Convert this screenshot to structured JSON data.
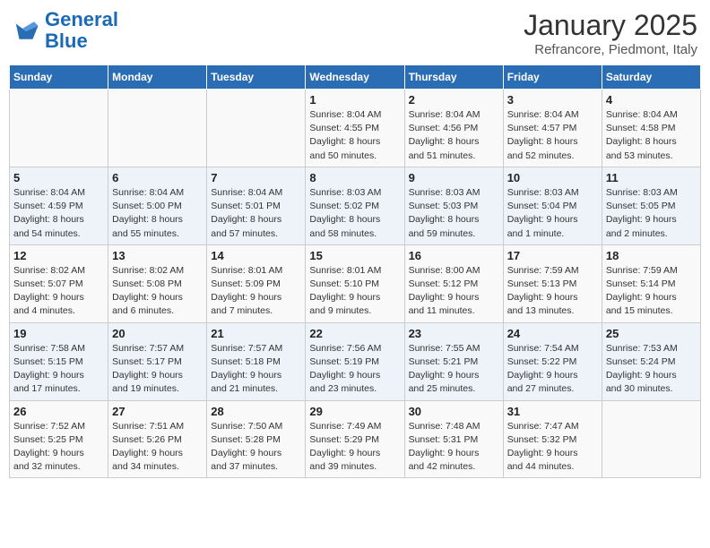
{
  "logo": {
    "line1": "General",
    "line2": "Blue"
  },
  "title": "January 2025",
  "subtitle": "Refrancore, Piedmont, Italy",
  "weekdays": [
    "Sunday",
    "Monday",
    "Tuesday",
    "Wednesday",
    "Thursday",
    "Friday",
    "Saturday"
  ],
  "weeks": [
    [
      {
        "day": "",
        "info": ""
      },
      {
        "day": "",
        "info": ""
      },
      {
        "day": "",
        "info": ""
      },
      {
        "day": "1",
        "info": "Sunrise: 8:04 AM\nSunset: 4:55 PM\nDaylight: 8 hours\nand 50 minutes."
      },
      {
        "day": "2",
        "info": "Sunrise: 8:04 AM\nSunset: 4:56 PM\nDaylight: 8 hours\nand 51 minutes."
      },
      {
        "day": "3",
        "info": "Sunrise: 8:04 AM\nSunset: 4:57 PM\nDaylight: 8 hours\nand 52 minutes."
      },
      {
        "day": "4",
        "info": "Sunrise: 8:04 AM\nSunset: 4:58 PM\nDaylight: 8 hours\nand 53 minutes."
      }
    ],
    [
      {
        "day": "5",
        "info": "Sunrise: 8:04 AM\nSunset: 4:59 PM\nDaylight: 8 hours\nand 54 minutes."
      },
      {
        "day": "6",
        "info": "Sunrise: 8:04 AM\nSunset: 5:00 PM\nDaylight: 8 hours\nand 55 minutes."
      },
      {
        "day": "7",
        "info": "Sunrise: 8:04 AM\nSunset: 5:01 PM\nDaylight: 8 hours\nand 57 minutes."
      },
      {
        "day": "8",
        "info": "Sunrise: 8:03 AM\nSunset: 5:02 PM\nDaylight: 8 hours\nand 58 minutes."
      },
      {
        "day": "9",
        "info": "Sunrise: 8:03 AM\nSunset: 5:03 PM\nDaylight: 8 hours\nand 59 minutes."
      },
      {
        "day": "10",
        "info": "Sunrise: 8:03 AM\nSunset: 5:04 PM\nDaylight: 9 hours\nand 1 minute."
      },
      {
        "day": "11",
        "info": "Sunrise: 8:03 AM\nSunset: 5:05 PM\nDaylight: 9 hours\nand 2 minutes."
      }
    ],
    [
      {
        "day": "12",
        "info": "Sunrise: 8:02 AM\nSunset: 5:07 PM\nDaylight: 9 hours\nand 4 minutes."
      },
      {
        "day": "13",
        "info": "Sunrise: 8:02 AM\nSunset: 5:08 PM\nDaylight: 9 hours\nand 6 minutes."
      },
      {
        "day": "14",
        "info": "Sunrise: 8:01 AM\nSunset: 5:09 PM\nDaylight: 9 hours\nand 7 minutes."
      },
      {
        "day": "15",
        "info": "Sunrise: 8:01 AM\nSunset: 5:10 PM\nDaylight: 9 hours\nand 9 minutes."
      },
      {
        "day": "16",
        "info": "Sunrise: 8:00 AM\nSunset: 5:12 PM\nDaylight: 9 hours\nand 11 minutes."
      },
      {
        "day": "17",
        "info": "Sunrise: 7:59 AM\nSunset: 5:13 PM\nDaylight: 9 hours\nand 13 minutes."
      },
      {
        "day": "18",
        "info": "Sunrise: 7:59 AM\nSunset: 5:14 PM\nDaylight: 9 hours\nand 15 minutes."
      }
    ],
    [
      {
        "day": "19",
        "info": "Sunrise: 7:58 AM\nSunset: 5:15 PM\nDaylight: 9 hours\nand 17 minutes."
      },
      {
        "day": "20",
        "info": "Sunrise: 7:57 AM\nSunset: 5:17 PM\nDaylight: 9 hours\nand 19 minutes."
      },
      {
        "day": "21",
        "info": "Sunrise: 7:57 AM\nSunset: 5:18 PM\nDaylight: 9 hours\nand 21 minutes."
      },
      {
        "day": "22",
        "info": "Sunrise: 7:56 AM\nSunset: 5:19 PM\nDaylight: 9 hours\nand 23 minutes."
      },
      {
        "day": "23",
        "info": "Sunrise: 7:55 AM\nSunset: 5:21 PM\nDaylight: 9 hours\nand 25 minutes."
      },
      {
        "day": "24",
        "info": "Sunrise: 7:54 AM\nSunset: 5:22 PM\nDaylight: 9 hours\nand 27 minutes."
      },
      {
        "day": "25",
        "info": "Sunrise: 7:53 AM\nSunset: 5:24 PM\nDaylight: 9 hours\nand 30 minutes."
      }
    ],
    [
      {
        "day": "26",
        "info": "Sunrise: 7:52 AM\nSunset: 5:25 PM\nDaylight: 9 hours\nand 32 minutes."
      },
      {
        "day": "27",
        "info": "Sunrise: 7:51 AM\nSunset: 5:26 PM\nDaylight: 9 hours\nand 34 minutes."
      },
      {
        "day": "28",
        "info": "Sunrise: 7:50 AM\nSunset: 5:28 PM\nDaylight: 9 hours\nand 37 minutes."
      },
      {
        "day": "29",
        "info": "Sunrise: 7:49 AM\nSunset: 5:29 PM\nDaylight: 9 hours\nand 39 minutes."
      },
      {
        "day": "30",
        "info": "Sunrise: 7:48 AM\nSunset: 5:31 PM\nDaylight: 9 hours\nand 42 minutes."
      },
      {
        "day": "31",
        "info": "Sunrise: 7:47 AM\nSunset: 5:32 PM\nDaylight: 9 hours\nand 44 minutes."
      },
      {
        "day": "",
        "info": ""
      }
    ]
  ]
}
